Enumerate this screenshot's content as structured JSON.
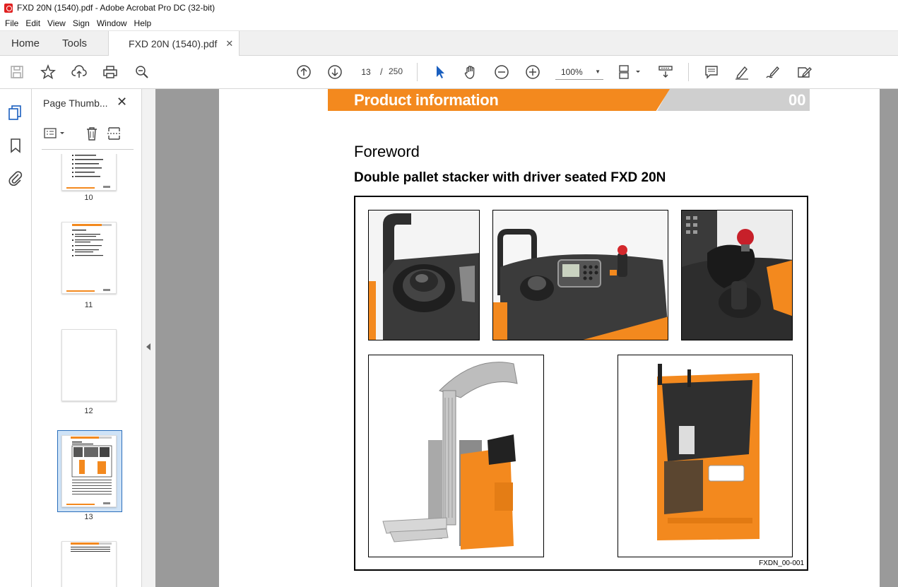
{
  "window": {
    "title": "FXD 20N (1540).pdf - Adobe Acrobat Pro DC (32-bit)"
  },
  "menu": [
    "File",
    "Edit",
    "View",
    "Sign",
    "Window",
    "Help"
  ],
  "tabs": {
    "home": "Home",
    "tools": "Tools",
    "document": "FXD 20N (1540).pdf"
  },
  "toolbar": {
    "current_page": "13",
    "separator": "/",
    "total_pages": "250",
    "zoom": "100%"
  },
  "panel": {
    "title": "Page Thumb...",
    "thumbnails": [
      {
        "label": "10"
      },
      {
        "label": "11"
      },
      {
        "label": "12"
      },
      {
        "label": "13",
        "selected": true
      }
    ]
  },
  "document": {
    "header_title": "Product information",
    "header_number": "00",
    "heading": "Foreword",
    "subheading": "Double pallet stacker with driver seated FXD 20N",
    "figure_caption": "FXDN_00-001"
  },
  "colors": {
    "accent_orange": "#f3891e",
    "header_gray": "#cfcfcf",
    "selection_blue": "#2a6ebb"
  }
}
